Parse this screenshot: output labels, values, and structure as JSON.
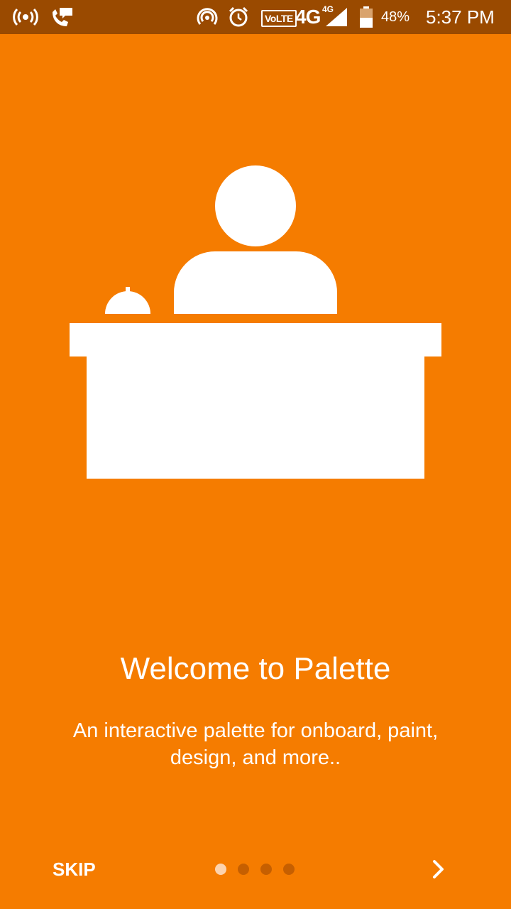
{
  "status_bar": {
    "volte": "VoLTE",
    "network": "4G",
    "network_small": "4G",
    "battery": "48%",
    "time": "5:37 PM",
    "background_color": "#9a4a00"
  },
  "onboarding": {
    "title": "Welcome to Palette",
    "description": "An interactive palette for onboard, paint, design, and more..",
    "illustration": "reception-desk-with-bell",
    "background_color": "#f57c00"
  },
  "footer": {
    "skip_label": "SKIP",
    "next_icon": "chevron-right-icon",
    "page_count": 4,
    "current_page": 1
  }
}
